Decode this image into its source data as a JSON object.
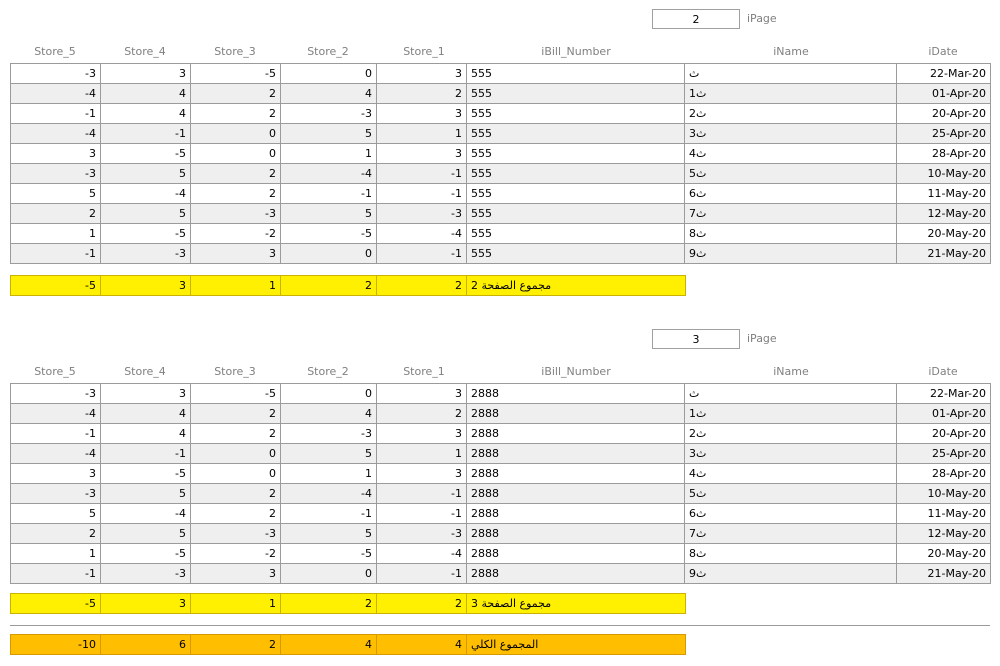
{
  "headers": {
    "store_5": "Store_5",
    "store_4": "Store_4",
    "store_3": "Store_3",
    "store_2": "Store_2",
    "store_1": "Store_1",
    "bill": "iBill_Number",
    "name": "iName",
    "date": "iDate"
  },
  "page_label": "iPage",
  "block1": {
    "page": "2",
    "rows": [
      {
        "s5": "-3",
        "s4": "3",
        "s3": "-5",
        "s2": "0",
        "s1": "3",
        "bill": "555",
        "name": "ث",
        "date": "22-Mar-20"
      },
      {
        "s5": "-4",
        "s4": "4",
        "s3": "2",
        "s2": "4",
        "s1": "2",
        "bill": "555",
        "name": "ث1",
        "date": "01-Apr-20"
      },
      {
        "s5": "-1",
        "s4": "4",
        "s3": "2",
        "s2": "-3",
        "s1": "3",
        "bill": "555",
        "name": "ث2",
        "date": "20-Apr-20"
      },
      {
        "s5": "-4",
        "s4": "-1",
        "s3": "0",
        "s2": "5",
        "s1": "1",
        "bill": "555",
        "name": "ث3",
        "date": "25-Apr-20"
      },
      {
        "s5": "3",
        "s4": "-5",
        "s3": "0",
        "s2": "1",
        "s1": "3",
        "bill": "555",
        "name": "ث4",
        "date": "28-Apr-20"
      },
      {
        "s5": "-3",
        "s4": "5",
        "s3": "2",
        "s2": "-4",
        "s1": "-1",
        "bill": "555",
        "name": "ث5",
        "date": "10-May-20"
      },
      {
        "s5": "5",
        "s4": "-4",
        "s3": "2",
        "s2": "-1",
        "s1": "-1",
        "bill": "555",
        "name": "ث6",
        "date": "11-May-20"
      },
      {
        "s5": "2",
        "s4": "5",
        "s3": "-3",
        "s2": "5",
        "s1": "-3",
        "bill": "555",
        "name": "ث7",
        "date": "12-May-20"
      },
      {
        "s5": "1",
        "s4": "-5",
        "s3": "-2",
        "s2": "-5",
        "s1": "-4",
        "bill": "555",
        "name": "ث8",
        "date": "20-May-20"
      },
      {
        "s5": "-1",
        "s4": "-3",
        "s3": "3",
        "s2": "0",
        "s1": "-1",
        "bill": "555",
        "name": "ث9",
        "date": "21-May-20"
      }
    ],
    "total": {
      "s5": "-5",
      "s4": "3",
      "s3": "1",
      "s2": "2",
      "s1": "2",
      "label": "مجموع الصفحة 2"
    }
  },
  "block2": {
    "page": "3",
    "rows": [
      {
        "s5": "-3",
        "s4": "3",
        "s3": "-5",
        "s2": "0",
        "s1": "3",
        "bill": "2888",
        "name": "ث",
        "date": "22-Mar-20"
      },
      {
        "s5": "-4",
        "s4": "4",
        "s3": "2",
        "s2": "4",
        "s1": "2",
        "bill": "2888",
        "name": "ث1",
        "date": "01-Apr-20"
      },
      {
        "s5": "-1",
        "s4": "4",
        "s3": "2",
        "s2": "-3",
        "s1": "3",
        "bill": "2888",
        "name": "ث2",
        "date": "20-Apr-20"
      },
      {
        "s5": "-4",
        "s4": "-1",
        "s3": "0",
        "s2": "5",
        "s1": "1",
        "bill": "2888",
        "name": "ث3",
        "date": "25-Apr-20"
      },
      {
        "s5": "3",
        "s4": "-5",
        "s3": "0",
        "s2": "1",
        "s1": "3",
        "bill": "2888",
        "name": "ث4",
        "date": "28-Apr-20"
      },
      {
        "s5": "-3",
        "s4": "5",
        "s3": "2",
        "s2": "-4",
        "s1": "-1",
        "bill": "2888",
        "name": "ث5",
        "date": "10-May-20"
      },
      {
        "s5": "5",
        "s4": "-4",
        "s3": "2",
        "s2": "-1",
        "s1": "-1",
        "bill": "2888",
        "name": "ث6",
        "date": "11-May-20"
      },
      {
        "s5": "2",
        "s4": "5",
        "s3": "-3",
        "s2": "5",
        "s1": "-3",
        "bill": "2888",
        "name": "ث7",
        "date": "12-May-20"
      },
      {
        "s5": "1",
        "s4": "-5",
        "s3": "-2",
        "s2": "-5",
        "s1": "-4",
        "bill": "2888",
        "name": "ث8",
        "date": "20-May-20"
      },
      {
        "s5": "-1",
        "s4": "-3",
        "s3": "3",
        "s2": "0",
        "s1": "-1",
        "bill": "2888",
        "name": "ث9",
        "date": "21-May-20"
      }
    ],
    "total": {
      "s5": "-5",
      "s4": "3",
      "s3": "1",
      "s2": "2",
      "s1": "2",
      "label": "مجموع الصفحة 3"
    }
  },
  "grand_total": {
    "s5": "-10",
    "s4": "6",
    "s3": "2",
    "s2": "4",
    "s1": "4",
    "label": "المجموع الكلي"
  },
  "colors": {
    "page_total_fill": "#ffef00",
    "grand_total_fill": "#ffbf00",
    "alt_row_fill": "#efefef",
    "header_text": "#7f7f7f"
  }
}
